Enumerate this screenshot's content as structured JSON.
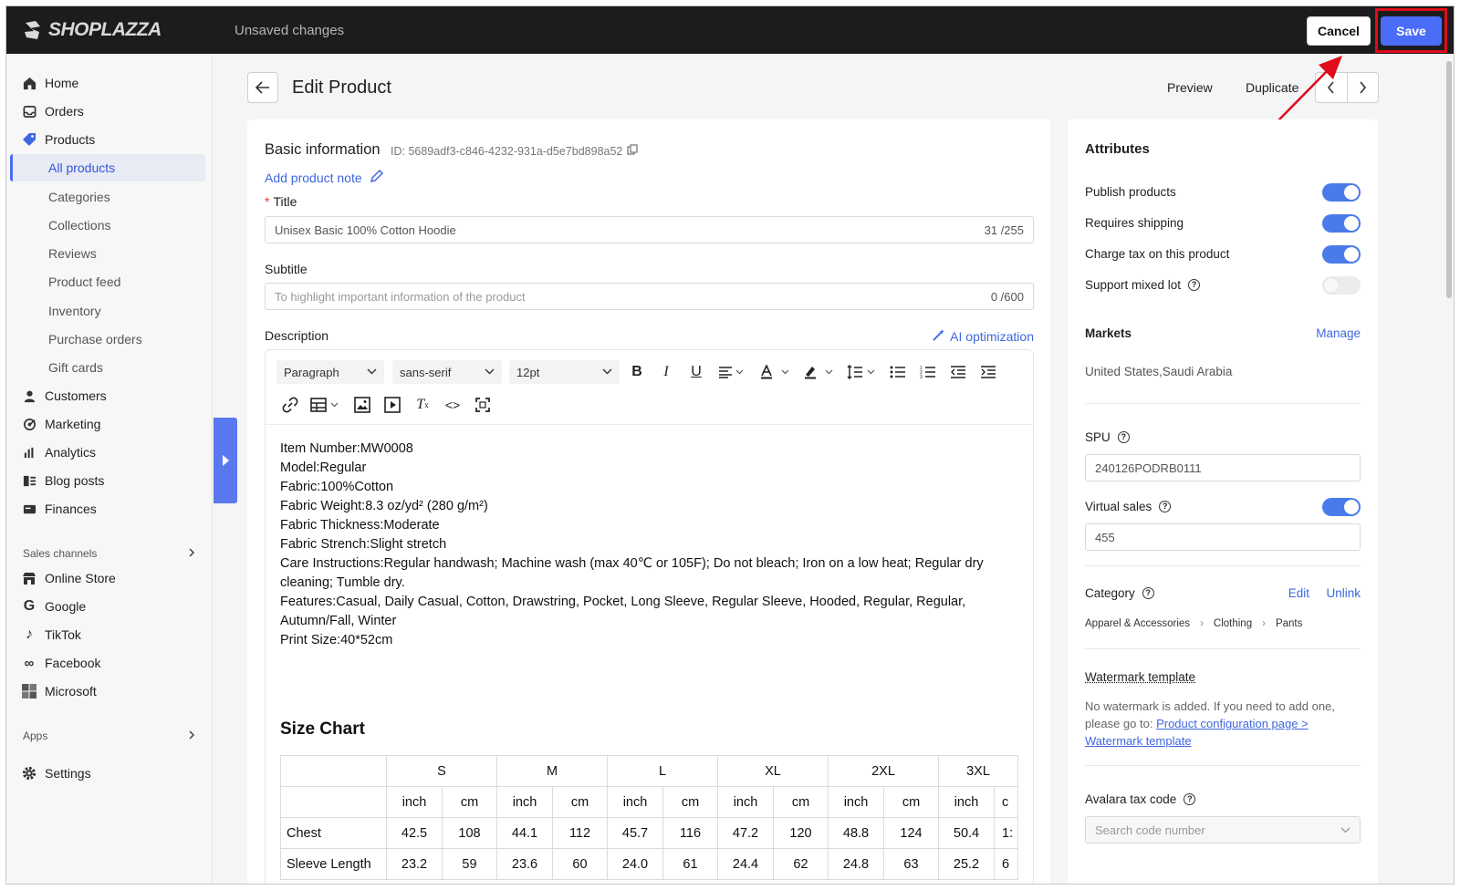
{
  "topbar": {
    "brand": "SHOPLAZZA",
    "status": "Unsaved changes",
    "cancel_label": "Cancel",
    "save_label": "Save"
  },
  "sidebar": {
    "items": [
      {
        "label": "Home",
        "icon": "home-icon"
      },
      {
        "label": "Orders",
        "icon": "orders-icon"
      },
      {
        "label": "Products",
        "icon": "tag-icon"
      },
      {
        "label": "Customers",
        "icon": "user-icon"
      },
      {
        "label": "Marketing",
        "icon": "marketing-icon"
      },
      {
        "label": "Analytics",
        "icon": "chart-icon"
      },
      {
        "label": "Blog posts",
        "icon": "blog-icon"
      },
      {
        "label": "Finances",
        "icon": "finance-icon"
      }
    ],
    "product_subitems": [
      "All products",
      "Categories",
      "Collections",
      "Reviews",
      "Product feed",
      "Inventory",
      "Purchase orders",
      "Gift cards"
    ],
    "sales_channels_header": "Sales channels",
    "sales_channels": [
      "Online Store",
      "Google",
      "TikTok",
      "Facebook",
      "Microsoft"
    ],
    "apps_header": "Apps",
    "settings_label": "Settings"
  },
  "header": {
    "title": "Edit Product",
    "preview": "Preview",
    "duplicate": "Duplicate"
  },
  "basic": {
    "heading": "Basic information",
    "id_text": "ID: 5689adf3-c846-4232-931a-d5e7bd898a52",
    "add_note": "Add product note",
    "required_mark": "*",
    "title_label": "Title",
    "title_value": "Unisex Basic 100% Cotton Hoodie",
    "title_counter": "31 /255",
    "subtitle_label": "Subtitle",
    "subtitle_placeholder": "To highlight important information of the product",
    "subtitle_counter": "0 /600",
    "description_label": "Description",
    "ai_label": "AI optimization"
  },
  "editor": {
    "block_format": "Paragraph",
    "font_family": "sans-serif",
    "font_size": "12pt",
    "lines": [
      "Item Number:MW0008",
      "Model:Regular",
      "Fabric:100%Cotton",
      "Fabric Weight:8.3 oz/yd² (280 g/m²)",
      "Fabric Thickness:Moderate",
      "Fabric Strench:Slight stretch",
      "Care Instructions:Regular handwash; Machine wash (max 40℃ or 105F); Do not bleach; Iron on a low heat; Regular dry cleaning; Tumble dry.",
      "Features:Casual, Daily Casual, Cotton, Drawstring, Pocket, Long Sleeve, Regular Sleeve, Hooded, Regular, Regular, Autumn/Fall, Winter",
      "Print Size:40*52cm"
    ],
    "size_chart_title": "Size Chart",
    "sizes": [
      "S",
      "M",
      "L",
      "XL",
      "2XL",
      "3XL"
    ],
    "units": [
      "inch",
      "cm"
    ],
    "rows": [
      {
        "label": "Chest",
        "values": [
          "42.5",
          "108",
          "44.1",
          "112",
          "45.7",
          "116",
          "47.2",
          "120",
          "48.8",
          "124",
          "50.4",
          "1:"
        ]
      },
      {
        "label": "Sleeve Length",
        "values": [
          "23.2",
          "59",
          "23.6",
          "60",
          "24.0",
          "61",
          "24.4",
          "62",
          "24.8",
          "63",
          "25.2",
          "6"
        ]
      }
    ]
  },
  "attributes": {
    "heading": "Attributes",
    "toggles": [
      {
        "label": "Publish products",
        "on": true
      },
      {
        "label": "Requires shipping",
        "on": true
      },
      {
        "label": "Charge tax on this product",
        "on": true
      },
      {
        "label": "Support mixed lot",
        "on": false
      }
    ],
    "markets_label": "Markets",
    "markets_manage": "Manage",
    "markets_value": "United States,Saudi Arabia",
    "spu_label": "SPU",
    "spu_value": "240126PODRB0111",
    "virtual_sales_label": "Virtual sales",
    "virtual_sales_value": "455",
    "category_label": "Category",
    "category_edit": "Edit",
    "category_unlink": "Unlink",
    "category_path": [
      "Apparel & Accessories",
      "Clothing",
      "Pants"
    ],
    "watermark_label": "Watermark template",
    "watermark_text": "No watermark is added. If you need to add one, please go to:",
    "watermark_link": "Product configuration page > Watermark template",
    "avalara_label": "Avalara tax code",
    "avalara_placeholder": "Search code number"
  },
  "colors": {
    "accent": "#4a6cf7",
    "highlight": "#e10b1a",
    "link": "#3f67e0",
    "topbar": "#1c1c1e"
  }
}
